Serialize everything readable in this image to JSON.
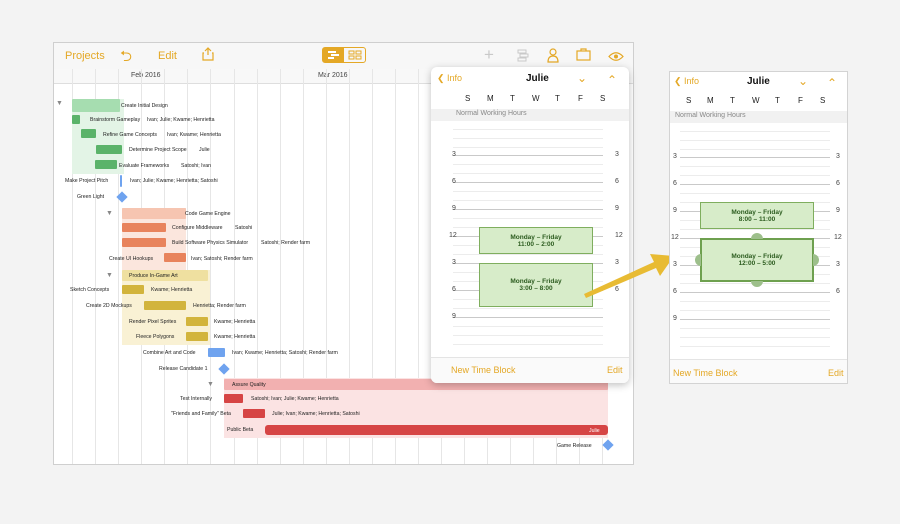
{
  "toolbar": {
    "projects_label": "Projects",
    "edit_label": "Edit"
  },
  "timescale": {
    "months": [
      "Feb 2016",
      "Mar 2016"
    ]
  },
  "tasks": [
    {
      "name": "Create Initial Design",
      "resources": ""
    },
    {
      "name": "Brainstorm Gameplay",
      "resources": "Ivan; Julie; Kwame; Henrietta"
    },
    {
      "name": "Refine Game Concepts",
      "resources": "Ivan; Kwame; Henrietta"
    },
    {
      "name": "Determine Project Scope",
      "resources": "Julie"
    },
    {
      "name": "Evaluate Frameworks",
      "resources": "Satoshi; Ivan"
    },
    {
      "name": "Make Project Pitch",
      "resources": "Ivan; Julie; Kwame; Henrietta; Satoshi"
    },
    {
      "name": "Green Light",
      "resources": ""
    },
    {
      "name": "Code Game Engine",
      "resources": ""
    },
    {
      "name": "Configure Middleware",
      "resources": "Satoshi"
    },
    {
      "name": "Build Software Physics Simulator",
      "resources": "Satoshi; Render farm"
    },
    {
      "name": "Create UI Hookups",
      "resources": "Ivan; Satoshi; Render farm"
    },
    {
      "name": "Produce In-Game Art",
      "resources": ""
    },
    {
      "name": "Sketch Concepts",
      "resources": "Kwame; Henrietta"
    },
    {
      "name": "Create 2D Mockups",
      "resources": "Henrietta; Render farm"
    },
    {
      "name": "Render Pixel Sprites",
      "resources": "Kwame; Henrietta"
    },
    {
      "name": "Fleece Polygons",
      "resources": "Kwame; Henrietta"
    },
    {
      "name": "Combine Art and Code",
      "resources": "Ivan; Kwame; Henrietta; Satoshi; Render farm"
    },
    {
      "name": "Release Candidate 1",
      "resources": ""
    },
    {
      "name": "Assure Quality",
      "resources": ""
    },
    {
      "name": "Test Internally",
      "resources": "Satoshi; Ivan; Julie; Kwame; Henrietta"
    },
    {
      "name": "\"Friends and Family\" Beta",
      "resources": "Julie; Ivan; Kwame; Henrietta; Satoshi"
    },
    {
      "name": "Public Beta",
      "resources": "Julie"
    },
    {
      "name": "Game Release",
      "resources": ""
    }
  ],
  "popover": {
    "back_label": "Info",
    "title": "Julie",
    "days": [
      "S",
      "M",
      "T",
      "W",
      "T",
      "F",
      "S"
    ],
    "section_label": "Normal Working Hours",
    "hours": [
      "3",
      "6",
      "9",
      "12",
      "3",
      "6",
      "9"
    ],
    "blocks": [
      {
        "days": "Monday – Friday",
        "time": "11:00 – 2:00"
      },
      {
        "days": "Monday – Friday",
        "time": "3:00 – 8:00"
      }
    ],
    "new_label": "New Time Block",
    "edit_label": "Edit"
  },
  "panel": {
    "back_label": "Info",
    "title": "Julie",
    "days": [
      "S",
      "M",
      "T",
      "W",
      "T",
      "F",
      "S"
    ],
    "section_label": "Normal Working Hours",
    "hours": [
      "3",
      "6",
      "9",
      "12",
      "3",
      "6",
      "9"
    ],
    "blocks": [
      {
        "days": "Monday – Friday",
        "time": "8:00 – 11:00"
      },
      {
        "days": "Monday – Friday",
        "time": "12:00 – 5:00"
      }
    ],
    "new_label": "New Time Block",
    "edit_label": "Edit"
  },
  "colors": {
    "accent": "#e4a826",
    "block_fill": "#d7ecc9",
    "block_border": "#7fae5e",
    "design_group": "#9fd9a9",
    "code_group": "#e8835c",
    "art_group": "#d2b43c",
    "qa_group": "#d64545",
    "milestone": "#6fa3ef"
  }
}
